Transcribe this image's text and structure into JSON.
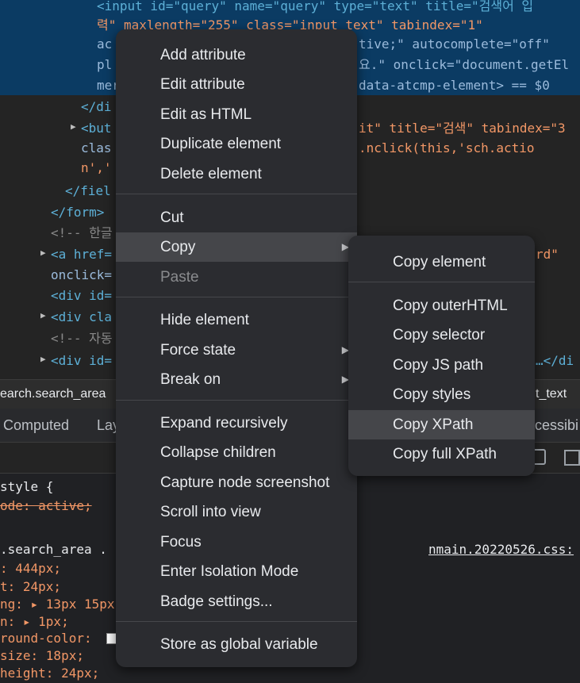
{
  "dom": {
    "lines": [
      [
        "<input id=\"query\" name=\"query\" type=\"text\" title=\"검색어 입"
      ],
      [
        "력\" maxlength=\"255\" class=\"input_text\" tabindex=\"1\""
      ],
      [
        "ac",
        "tive;\" autocomplete=\"off\""
      ],
      [
        "pl",
        "요.\" onclick=\"document.getEl"
      ],
      [
        "mer",
        "data-atcmp-element> == $0"
      ],
      [
        "</di"
      ],
      [
        "<but",
        "it\" title=\"검색\" tabindex=\"3"
      ],
      [
        "clas",
        ".nclick(this,'sch.actio"
      ],
      [
        "n','"
      ],
      [
        "</fiel"
      ],
      [
        "</form>"
      ],
      [
        "<!-- 한글"
      ],
      [
        "<a href=",
        "rd\""
      ],
      [
        "onclick="
      ],
      [
        "<div id="
      ],
      [
        "<div cla"
      ],
      [
        "<!-- 자동"
      ],
      [
        "<div id=",
        "…</di"
      ]
    ]
  },
  "breadcrumb": {
    "left": "earch.search_area",
    "right": "t_text"
  },
  "tabs": {
    "computed": "Computed",
    "layout": "Lay",
    "accessibility": "cessibi"
  },
  "styles": {
    "lines": [
      "style {",
      "ode: active;",
      "",
      ".search_area .",
      ": 444px;",
      "t: 24px;",
      "ng: ▸ 13px 15px",
      "n: ▸ 1px;",
      "round-color: ",
      "size: 18px;",
      "height: 24px;"
    ],
    "source_link": "nmain.20220526.css:"
  },
  "context_menu": {
    "items": [
      "Add attribute",
      "Edit attribute",
      "Edit as HTML",
      "Duplicate element",
      "Delete element",
      "Cut",
      "Copy",
      "Paste",
      "Hide element",
      "Force state",
      "Break on",
      "Expand recursively",
      "Collapse children",
      "Capture node screenshot",
      "Scroll into view",
      "Focus",
      "Enter Isolation Mode",
      "Badge settings...",
      "Store as global variable"
    ]
  },
  "copy_submenu": {
    "items": [
      "Copy element",
      "Copy outerHTML",
      "Copy selector",
      "Copy JS path",
      "Copy styles",
      "Copy XPath",
      "Copy full XPath"
    ]
  },
  "colors": {
    "selection": "#0b3b63",
    "menu_bg": "#2b2c30",
    "hover": "#45464a",
    "tag": "#5db0d7",
    "value": "#f29766"
  },
  "icons": [
    "expand-triangle-icon",
    "submenu-arrow-icon",
    "toggle-icon",
    "panel-icon"
  ]
}
